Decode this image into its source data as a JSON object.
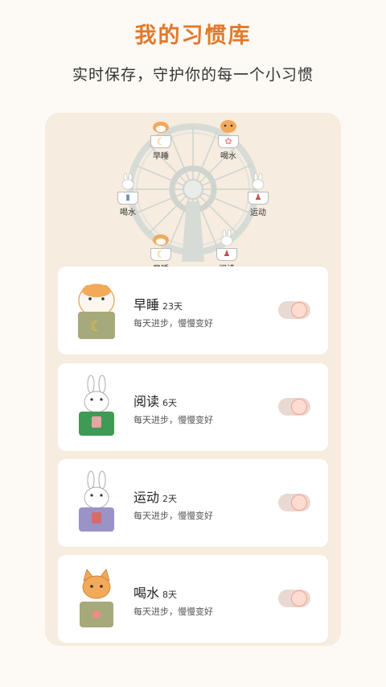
{
  "header": {
    "title": "我的习惯库",
    "subtitle": "实时保存，守护你的每一个小习惯"
  },
  "wheel": {
    "cabins": [
      {
        "label": "早睡",
        "icon": "moon-icon"
      },
      {
        "label": "喝水",
        "icon": "flower-icon"
      },
      {
        "label": "喝水",
        "icon": "bottle-icon"
      },
      {
        "label": "运动",
        "icon": "person-icon"
      },
      {
        "label": "早睡",
        "icon": "moon-icon"
      },
      {
        "label": "阅读",
        "icon": "person-icon"
      }
    ]
  },
  "habits": [
    {
      "name": "早睡",
      "days": "23天",
      "desc": "每天进步，慢慢变好",
      "pocket_color": "#a6a97a",
      "animal": "orange-cat"
    },
    {
      "name": "阅读",
      "days": "6天",
      "desc": "每天进步，慢慢变好",
      "pocket_color": "#3f9a55",
      "animal": "white-rabbit"
    },
    {
      "name": "运动",
      "days": "2天",
      "desc": "每天进步，慢慢变好",
      "pocket_color": "#9a93c8",
      "animal": "white-rabbit"
    },
    {
      "name": "喝水",
      "days": "8天",
      "desc": "每天进步，慢慢变好",
      "pocket_color": "#a6a97a",
      "animal": "orange-cat"
    }
  ],
  "colors": {
    "accent": "#e07a2c",
    "panel": "#f6ecdf",
    "toggle_track": "#e9d9d3",
    "toggle_knob": "#f4a38a"
  }
}
